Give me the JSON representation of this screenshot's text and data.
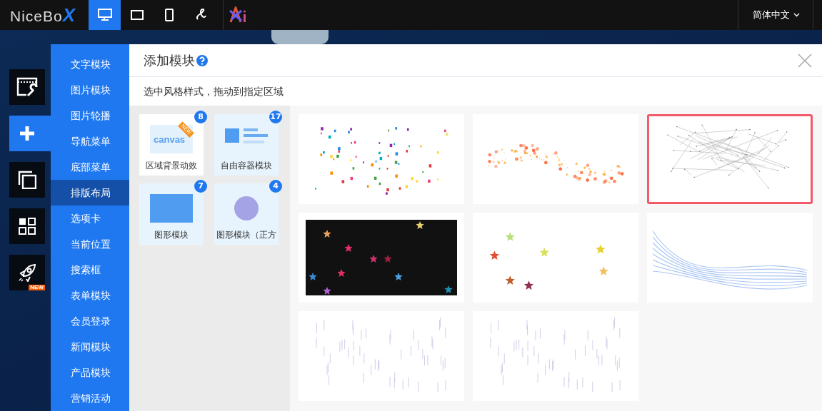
{
  "topbar": {
    "logo": {
      "text": "NiceBo",
      "accent": "X"
    },
    "devices": [
      {
        "kind": "desktop",
        "selected": true
      },
      {
        "kind": "tablet",
        "selected": false
      },
      {
        "kind": "phone",
        "selected": false
      },
      {
        "kind": "link",
        "selected": false
      }
    ],
    "language": "简体中文"
  },
  "side_tools": [
    {
      "kind": "window-tools",
      "selected": false
    },
    {
      "kind": "add",
      "selected": true
    },
    {
      "kind": "copy",
      "selected": false
    },
    {
      "kind": "grid",
      "selected": false
    },
    {
      "kind": "rocket",
      "selected": false,
      "badge": "NEW"
    }
  ],
  "menu": [
    {
      "label": "文字模块",
      "selected": false
    },
    {
      "label": "图片模块",
      "selected": false
    },
    {
      "label": "图片轮播",
      "selected": false
    },
    {
      "label": "导航菜单",
      "selected": false
    },
    {
      "label": "底部菜单",
      "selected": false
    },
    {
      "label": "排版布局",
      "selected": true
    },
    {
      "label": "选项卡",
      "selected": false
    },
    {
      "label": "当前位置",
      "selected": false
    },
    {
      "label": "搜索框",
      "selected": false
    },
    {
      "label": "表单模块",
      "selected": false
    },
    {
      "label": "会员登录",
      "selected": false
    },
    {
      "label": "新闻模块",
      "selected": false
    },
    {
      "label": "产品模块",
      "selected": false
    },
    {
      "label": "营销活动",
      "selected": false
    }
  ],
  "panel": {
    "title": "添加模块",
    "subtitle": "选中风格样式，拖动到指定区域",
    "categories": [
      {
        "kind": "canvas",
        "label": "区域背景动效",
        "count": "8",
        "selected": true,
        "icon_text": "canvas",
        "ribbon": "NEW"
      },
      {
        "kind": "container",
        "label": "自由容器模块",
        "count": "17",
        "selected": false
      },
      {
        "kind": "rect",
        "label": "图形模块",
        "count": "7",
        "selected": false
      },
      {
        "kind": "circle",
        "label": "图形模块（正方",
        "count": "4",
        "selected": false
      }
    ],
    "previews": [
      {
        "kind": "confetti",
        "selected": false
      },
      {
        "kind": "particle-wave",
        "selected": false
      },
      {
        "kind": "network",
        "selected": true
      },
      {
        "kind": "shooting-stars",
        "selected": false
      },
      {
        "kind": "stars",
        "selected": false
      },
      {
        "kind": "ribbon",
        "selected": false
      },
      {
        "kind": "rain",
        "selected": false
      },
      {
        "kind": "rain",
        "selected": false
      }
    ]
  }
}
